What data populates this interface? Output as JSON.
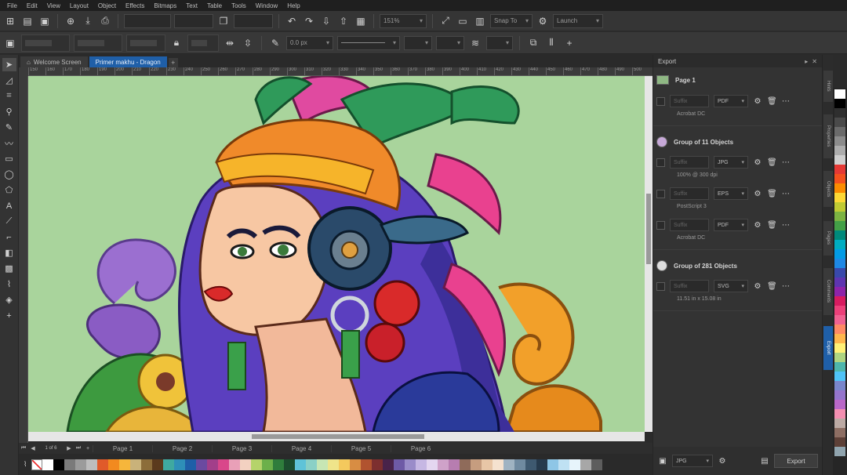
{
  "menu": [
    "File",
    "Edit",
    "View",
    "Layout",
    "Object",
    "Effects",
    "Bitmaps",
    "Text",
    "Table",
    "Tools",
    "Window",
    "Help"
  ],
  "toolbar": {
    "zoom": "151%",
    "snap": "Snap To",
    "launch": "Launch"
  },
  "property_bar": {
    "outline_width": "0.0 px"
  },
  "tabs": [
    {
      "label": "Welcome Screen",
      "active": false
    },
    {
      "label": "Primer makhu - Dragon",
      "active": true
    }
  ],
  "ruler_ticks": [
    "150",
    "160",
    "170",
    "180",
    "190",
    "200",
    "210",
    "220",
    "230",
    "240",
    "250",
    "260",
    "270",
    "280",
    "290",
    "300",
    "310",
    "320",
    "330",
    "340",
    "350",
    "360",
    "370",
    "380",
    "390",
    "400",
    "410",
    "420",
    "430",
    "440",
    "450",
    "460",
    "470",
    "480",
    "490",
    "500"
  ],
  "pages": [
    "Page 1",
    "Page 2",
    "Page 3",
    "Page 4",
    "Page 5",
    "Page 6"
  ],
  "page_nav": {
    "current": "1 of 6"
  },
  "docker": {
    "title": "Export",
    "groups": [
      {
        "title": "Page 1",
        "rows": [
          {
            "suffix": "Suffix",
            "format": "PDF",
            "note": "Acrobat DC"
          }
        ]
      },
      {
        "title": "Group of 11 Objects",
        "rows": [
          {
            "suffix": "Suffix",
            "format": "JPG",
            "note": "100% @ 300 dpi"
          },
          {
            "suffix": "Suffix",
            "format": "EPS",
            "note": "PostScript 3"
          },
          {
            "suffix": "Suffix",
            "format": "PDF",
            "note": "Acrobat DC"
          }
        ]
      },
      {
        "title": "Group of 281 Objects",
        "rows": [
          {
            "suffix": "Suffix",
            "format": "SVG",
            "note": "11.51 in x 15.08 in"
          }
        ]
      }
    ],
    "footer": {
      "format": "JPG",
      "export_label": "Export"
    }
  },
  "side_tabs": [
    "Hints",
    "Properties",
    "Objects",
    "Pages",
    "Comments",
    "Export"
  ],
  "palette_colors": [
    "#ffffff",
    "#000000",
    "#7a7a7a",
    "#9b9b9b",
    "#bdbdbd",
    "#e05a2a",
    "#f28a1f",
    "#f6b63b",
    "#c9b27a",
    "#8c6d3a",
    "#5b3a1d",
    "#3fa9a0",
    "#2e8fb8",
    "#1f5fa8",
    "#6b4aa0",
    "#a23f8a",
    "#d9478a",
    "#e9a0b8",
    "#f3d1c1",
    "#b5d36a",
    "#6cb04a",
    "#2f7d3c",
    "#1c4d2e",
    "#5fc3d8",
    "#8ad0c6",
    "#c7e6b4",
    "#efe48a",
    "#f4c95d",
    "#d88d43",
    "#b1532f",
    "#7d2f2f",
    "#49234a",
    "#6e5aa6",
    "#9a8cc9",
    "#c6b7e3",
    "#e4d6f0",
    "#cfa2c9",
    "#b77db0",
    "#8f6b5a",
    "#c69d7f",
    "#e8c6a6",
    "#f5e2cf",
    "#9fb3c2",
    "#6f8aa0",
    "#3e5970",
    "#263a4d",
    "#8ec6e6",
    "#bfe1f3",
    "#e7f4fb",
    "#a7a7a7",
    "#5d5d5d"
  ],
  "vpalette_colors": [
    "#ffffff",
    "#000000",
    "#2f2f2f",
    "#4a4a4a",
    "#6b6b6b",
    "#8c8c8c",
    "#adadad",
    "#cfcfcf",
    "#e53935",
    "#f4511e",
    "#fb8c00",
    "#fdd835",
    "#c0ca33",
    "#7cb342",
    "#43a047",
    "#00897b",
    "#00acc1",
    "#039be5",
    "#1e88e5",
    "#3949ab",
    "#5e35b1",
    "#8e24aa",
    "#d81b60",
    "#ec407a",
    "#f06292",
    "#ff8a65",
    "#ffb74d",
    "#fff176",
    "#aed581",
    "#4db6ac",
    "#4fc3f7",
    "#7986cb",
    "#9575cd",
    "#ba68c8",
    "#f48fb1",
    "#bcaaa4",
    "#8d6e63",
    "#5d4037",
    "#90a4ae"
  ]
}
